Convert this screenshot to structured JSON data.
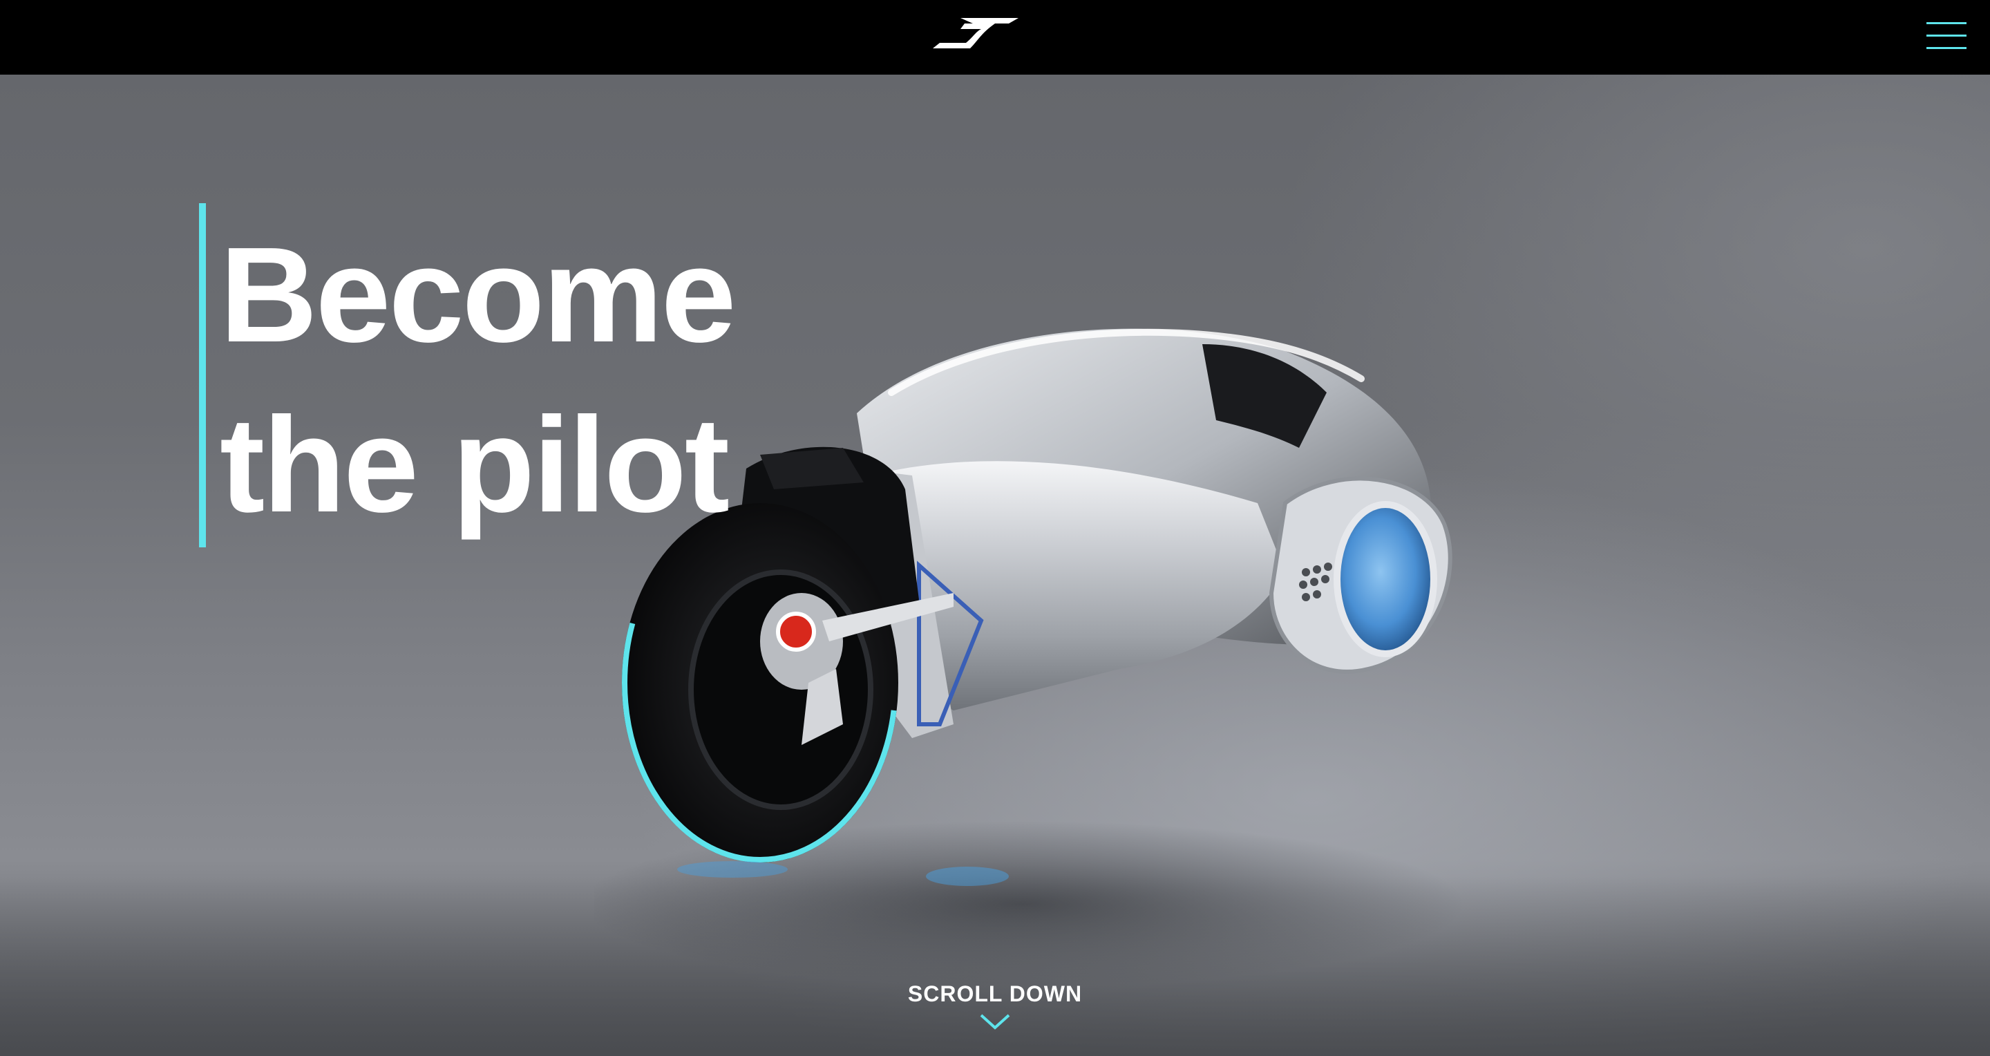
{
  "header": {
    "logo_icon": "brand-logo-icon",
    "menu_icon": "hamburger-menu-icon"
  },
  "hero": {
    "title_line_1": "Become",
    "title_line_2": "the pilot",
    "scroll_label": "SCROLL DOWN",
    "scroll_icon": "chevron-down-icon"
  },
  "colors": {
    "accent": "#5ee4ec",
    "header_bg": "#000000",
    "headline_text": "#ffffff",
    "bike_light_red": "#d8281c",
    "bike_light_blue": "#4a9fe0"
  }
}
